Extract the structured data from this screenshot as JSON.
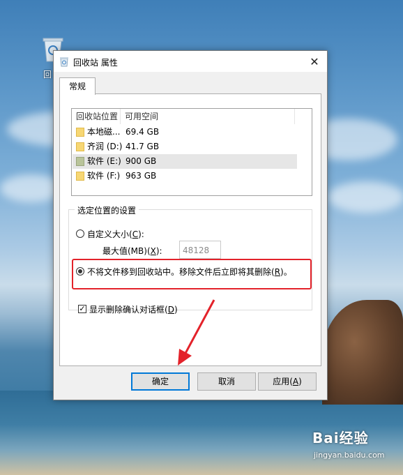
{
  "desktop": {
    "recycle_bin_label": "回",
    "watermark": {
      "brand": "Bai经验",
      "url": "jingyan.baidu.com"
    }
  },
  "dialog": {
    "title": "回收站 属性",
    "close_label": "✕",
    "tab_general": "常规",
    "columns": [
      "回收站位置",
      "可用空间"
    ],
    "locations": [
      {
        "name": "本地磁...",
        "free": "69.4 GB",
        "selected": false
      },
      {
        "name": "齐润 (D:)",
        "free": "41.7 GB",
        "selected": false
      },
      {
        "name": "软件 (E:)",
        "free": "900 GB",
        "selected": true
      },
      {
        "name": "软件 (F:)",
        "free": "963 GB",
        "selected": false
      }
    ],
    "settings_group_title": "选定位置的设置",
    "custom_size": {
      "text": "自定义大小(",
      "key": "C",
      "tail": "):"
    },
    "max_size": {
      "text": "最大值(MB)(",
      "key": "X",
      "tail": "):",
      "value": "48128"
    },
    "delete_immediately": {
      "text": "不将文件移到回收站中。移除文件后立即将其删除(",
      "key": "R",
      "tail": ")。"
    },
    "confirm_dialog": {
      "text": "显示删除确认对话框(",
      "key": "D",
      "tail": ")"
    },
    "buttons": {
      "ok": "确定",
      "cancel": "取消",
      "apply_text": "应用(",
      "apply_key": "A",
      "apply_tail": ")"
    },
    "selected_option": "delete_immediately",
    "confirm_checked": true
  },
  "colors": {
    "highlight_box": "#e3222a",
    "default_button_border": "#0078d7"
  }
}
